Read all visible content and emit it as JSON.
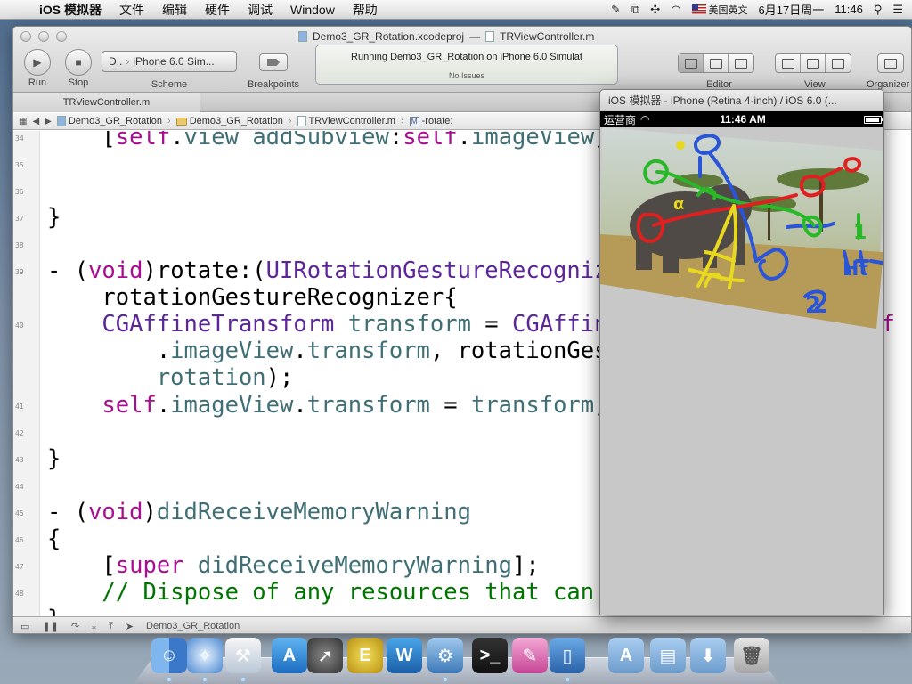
{
  "menubar": {
    "app_name": "iOS 模拟器",
    "items": [
      "文件",
      "编辑",
      "硬件",
      "调试",
      "Window",
      "帮助"
    ],
    "input_method": "美国英文",
    "date": "6月17日周一",
    "time": "11:46"
  },
  "xcode": {
    "window_title_project": "Demo3_GR_Rotation.xcodeproj",
    "window_title_separator": "—",
    "window_title_file": "TRViewController.m",
    "toolbar": {
      "run_label": "Run",
      "stop_label": "Stop",
      "scheme_target": "D..",
      "scheme_device": "iPhone 6.0 Sim...",
      "scheme_label": "Scheme",
      "breakpoints_label": "Breakpoints",
      "activity_status": "Running Demo3_GR_Rotation on iPhone 6.0 Simulat",
      "activity_issues": "No Issues",
      "editor_label": "Editor",
      "view_label": "View",
      "organizer_label": "Organizer"
    },
    "tab_title": "TRViewController.m",
    "jumpbar": [
      "Demo3_GR_Rotation",
      "Demo3_GR_Rotation",
      "TRViewController.m",
      "-rotate:"
    ],
    "code_lines": [
      {
        "n": "34",
        "text": "    [self.view addSubview:self.imageView];"
      },
      {
        "n": "35",
        "text": ""
      },
      {
        "n": "36",
        "text": ""
      },
      {
        "n": "37",
        "text": "}"
      },
      {
        "n": "38",
        "text": ""
      },
      {
        "n": "39",
        "text": "- (void)rotate:(UIRotationGestureRecognizer *)"
      },
      {
        "n": "",
        "text": "    rotationGestureRecognizer{"
      },
      {
        "n": "40",
        "text": "    CGAffineTransform transform = CGAffineTransformRotate(self"
      },
      {
        "n": "",
        "text": "        .imageView.transform, rotationGestureRecognizer."
      },
      {
        "n": "",
        "text": "        rotation);"
      },
      {
        "n": "41",
        "text": "    self.imageView.transform = transform;"
      },
      {
        "n": "42",
        "text": ""
      },
      {
        "n": "43",
        "text": "}"
      },
      {
        "n": "44",
        "text": ""
      },
      {
        "n": "45",
        "text": "- (void)didReceiveMemoryWarning"
      },
      {
        "n": "46",
        "text": "{"
      },
      {
        "n": "47",
        "text": "    [super didReceiveMemoryWarning];"
      },
      {
        "n": "48",
        "text": "    // Dispose of any resources that can be recreated."
      },
      {
        "n": "",
        "text": "}"
      }
    ],
    "debug_target": "Demo3_GR_Rotation"
  },
  "simulator": {
    "title": "iOS 模拟器 - iPhone (Retina 4-inch) / iOS 6.0 (...",
    "carrier": "运营商",
    "time": "11:46 AM",
    "image_annotations": [
      "α",
      "1",
      "Ht",
      "2"
    ]
  },
  "colors": {
    "keyword": "#aa0d91",
    "type": "#5c2699",
    "property": "#3f6e74",
    "comment": "#007400"
  },
  "dock": {
    "icons": [
      "finder-icon",
      "safari-icon",
      "xcode-icon",
      "app-store-icon",
      "launchpad-icon",
      "tweak-icon",
      "word-icon",
      "instruments-icon",
      "terminal-icon",
      "simulator-icon",
      "ios-simulator-icon",
      "applications-folder-icon",
      "documents-folder-icon",
      "downloads-folder-icon",
      "trash-icon"
    ]
  }
}
